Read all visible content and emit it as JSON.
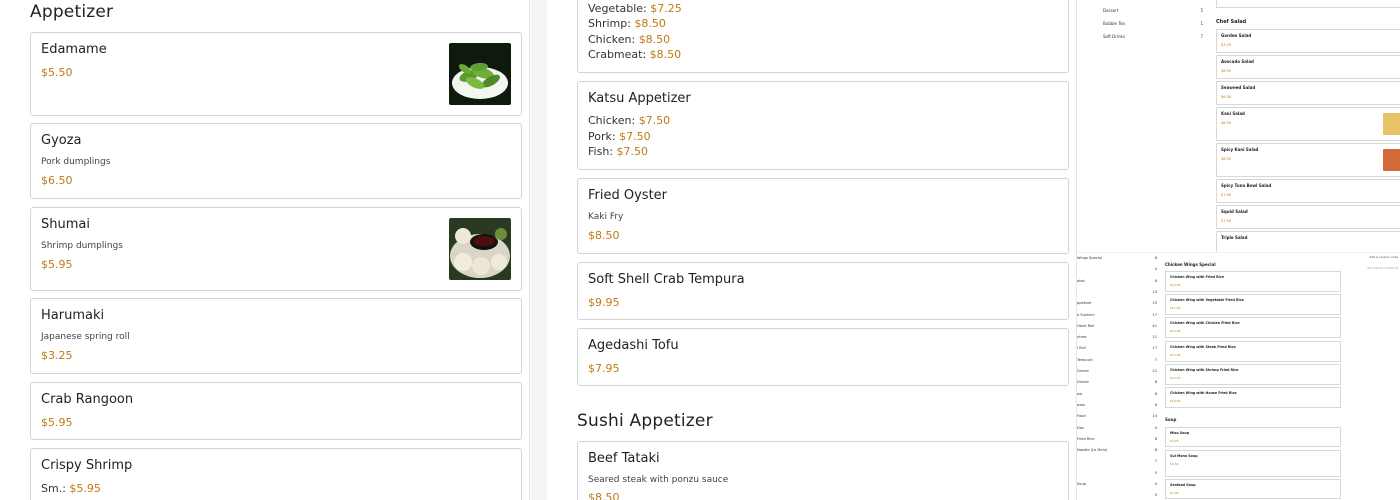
{
  "left": {
    "section_title": "Appetizer",
    "items": [
      {
        "name": "Edamame",
        "desc": "",
        "price": "$5.50",
        "image": "edamame-photo"
      },
      {
        "name": "Gyoza",
        "desc": "Pork dumplings",
        "price": "$6.50"
      },
      {
        "name": "Shumai",
        "desc": "Shrimp dumplings",
        "price": "$5.95",
        "image": "shumai-photo"
      },
      {
        "name": "Harumaki",
        "desc": "Japanese spring roll",
        "price": "$3.25"
      },
      {
        "name": "Crab Rangoon",
        "desc": "",
        "price": "$5.95"
      },
      {
        "name": "Crispy Shrimp",
        "desc": "",
        "sizes": [
          {
            "label": "Sm.:",
            "price": "$5.95"
          }
        ]
      }
    ]
  },
  "middle": {
    "partial_card": {
      "lines": [
        {
          "label": "Vegetable:",
          "price": "$7.25"
        },
        {
          "label": "Shrimp:",
          "price": "$8.50"
        },
        {
          "label": "Chicken:",
          "price": "$8.50"
        },
        {
          "label": "Crabmeat:",
          "price": "$8.50"
        }
      ]
    },
    "items": [
      {
        "name": "Katsu Appetizer",
        "lines": [
          {
            "label": "Chicken:",
            "price": "$7.50"
          },
          {
            "label": "Pork:",
            "price": "$7.50"
          },
          {
            "label": "Fish:",
            "price": "$7.50"
          }
        ]
      },
      {
        "name": "Fried Oyster",
        "desc": "Kaki Fry",
        "price": "$8.50"
      },
      {
        "name": "Soft Shell Crab Tempura",
        "price": "$9.95"
      },
      {
        "name": "Agedashi Tofu",
        "price": "$7.95"
      }
    ],
    "section_title": "Sushi Appetizer",
    "sushi_items": [
      {
        "name": "Beef Tataki",
        "desc": "Seared steak with ponzu sauce",
        "price": "$8.50"
      }
    ]
  },
  "right_preview_top": {
    "categories": [
      {
        "name": "Dessert",
        "count": "5"
      },
      {
        "name": "Bubble Tea",
        "count": "1"
      },
      {
        "name": "Soft Drinks",
        "count": "7"
      }
    ],
    "heading": "Chef Salad",
    "items": [
      {
        "name": "Garden Salad",
        "price": "$3.25"
      },
      {
        "name": "Avocado Salad",
        "price": "$6.95"
      },
      {
        "name": "Seaweed Salad",
        "price": "$6.50"
      },
      {
        "name": "Kani Salad",
        "price": "$6.50"
      },
      {
        "name": "Spicy Kani Salad",
        "price": "$6.50"
      },
      {
        "name": "Spicy Tuna Bowl Salad",
        "price": "$7.95"
      },
      {
        "name": "Squid Salad",
        "price": "$7.50"
      },
      {
        "name": "Triple Salad",
        "price": ""
      }
    ]
  },
  "right_preview_bottom": {
    "categories": [
      {
        "name": "Wings Special",
        "count": "6"
      },
      {
        "name": "",
        "count": "4"
      },
      {
        "name": "alad",
        "count": "8"
      },
      {
        "name": "",
        "count": "13"
      },
      {
        "name": "ppetizer",
        "count": "15"
      },
      {
        "name": "e Sushimi",
        "count": "17"
      },
      {
        "name": "Hand Roll",
        "count": "41"
      },
      {
        "name": "ntree",
        "count": "11"
      },
      {
        "name": "l Roll",
        "count": "17"
      },
      {
        "name": "Tempura",
        "count": "7"
      },
      {
        "name": "Dinner",
        "count": "22"
      },
      {
        "name": "Dinner",
        "count": "8"
      },
      {
        "name": "ow",
        "count": "6"
      },
      {
        "name": "owls",
        "count": "6"
      },
      {
        "name": "Food",
        "count": "14"
      },
      {
        "name": "Don",
        "count": "4"
      },
      {
        "name": "Fried Rice",
        "count": "8"
      },
      {
        "name": "Noodle (Lo Mein)",
        "count": "8"
      },
      {
        "name": "",
        "count": "7"
      },
      {
        "name": "",
        "count": "5"
      },
      {
        "name": "Soup",
        "count": "4"
      },
      {
        "name": "",
        "count": "5"
      }
    ],
    "heading_wings": "Chicken Wings Special",
    "wings": [
      {
        "name": "Chicken Wing with Fried Rice",
        "price": "$10.95"
      },
      {
        "name": "Chicken Wing with Vegetable Fried Rice",
        "price": "$11.95"
      },
      {
        "name": "Chicken Wing with Chicken Fried Rice",
        "price": "$12.95"
      },
      {
        "name": "Chicken Wing with Steak Fried Rice",
        "price": "$13.95"
      },
      {
        "name": "Chicken Wing with Shrimp Fried Rice",
        "price": "$13.95"
      },
      {
        "name": "Chicken Wing with House Fried Rice",
        "price": "$14.95"
      }
    ],
    "heading_soup": "Soup",
    "soups": [
      {
        "name": "Miso Soup",
        "price": "$3.25"
      },
      {
        "name": "Sui Mono Soup",
        "price": "$3.50"
      },
      {
        "name": "Seafood Soup",
        "price": "$7.95"
      }
    ],
    "side": {
      "coupon": "Add a coupon code",
      "checkout": "Proceed to checkout"
    }
  }
}
